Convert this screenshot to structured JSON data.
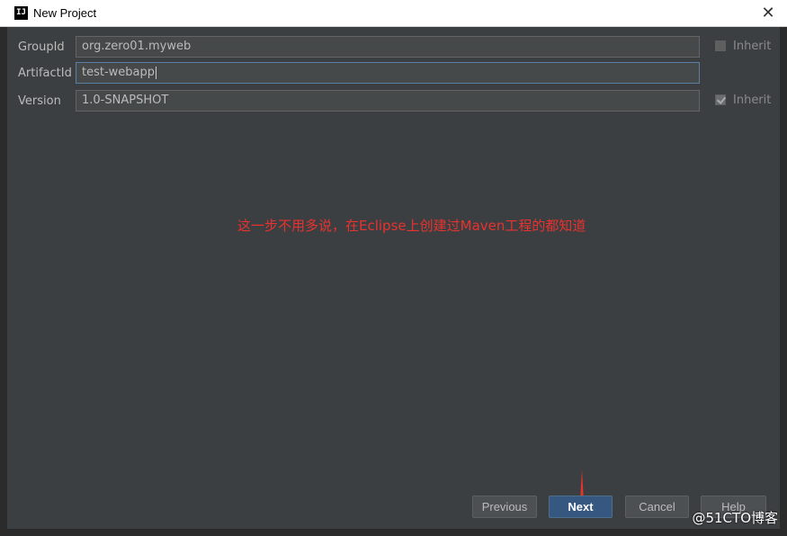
{
  "window": {
    "title": "New Project",
    "icon_label": "IJ"
  },
  "form": {
    "group_id": {
      "label": "GroupId",
      "value": "org.zero01.myweb",
      "inherit_label": "Inherit",
      "inherit_checked": false
    },
    "artifact_id": {
      "label": "ArtifactId",
      "value": "test-webapp"
    },
    "version": {
      "label": "Version",
      "value": "1.0-SNAPSHOT",
      "inherit_label": "Inherit",
      "inherit_checked": true
    }
  },
  "annotation": {
    "text": "这一步不用多说，在Eclipse上创建过Maven工程的都知道",
    "color": "#e8322f"
  },
  "buttons": {
    "previous": "Previous",
    "next": "Next",
    "cancel": "Cancel",
    "help": "Help"
  },
  "watermark": "@51CTO博客",
  "colors": {
    "background": "#3c3f41",
    "primary_button": "#365880",
    "arrow": "#e8322f"
  }
}
